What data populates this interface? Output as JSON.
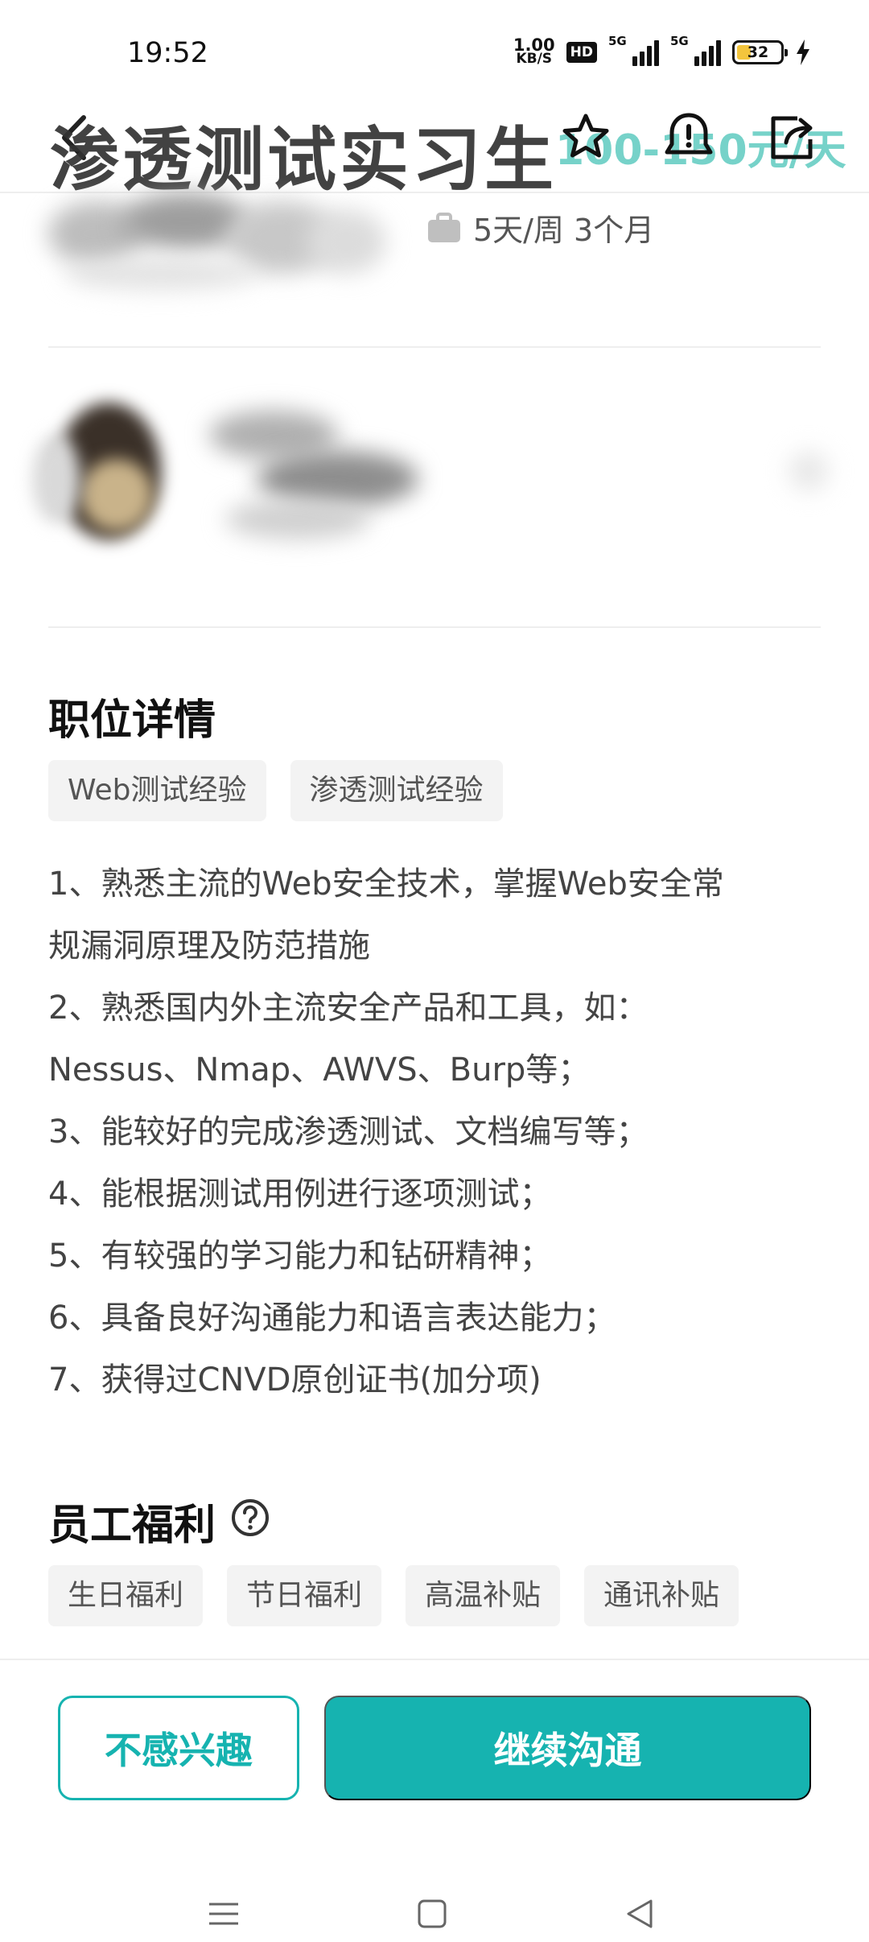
{
  "status_bar": {
    "time": "19:52",
    "net_speed_value": "1.00",
    "net_speed_unit": "KB/S",
    "hd_label": "HD",
    "signal1_label": "5G",
    "signal2_label": "5G",
    "battery_level": "32"
  },
  "header": {
    "title": "渗透测试实习生",
    "salary": "100-150元/天"
  },
  "job_meta": {
    "schedule": "5天/周 3个月"
  },
  "job_details": {
    "title": "职位详情",
    "tags": [
      "Web测试经验",
      "渗透测试经验"
    ],
    "lines": [
      "1、熟悉主流的Web安全技术，掌握Web安全常",
      "规漏洞原理及防范措施",
      "2、熟悉国内外主流安全产品和工具，如：",
      "Nessus、Nmap、AWVS、Burp等；",
      "3、能较好的完成渗透测试、文档编写等；",
      "4、能根据测试用例进行逐项测试；",
      "5、有较强的学习能力和钻研精神；",
      "6、具备良好沟通能力和语言表达能力；",
      "7、获得过CNVD原创证书(加分项)"
    ]
  },
  "benefits": {
    "title": "员工福利",
    "tags": [
      "生日福利",
      "节日福利",
      "高温补贴",
      "通讯补贴"
    ]
  },
  "actions": {
    "not_interested": "不感兴趣",
    "continue_chat": "继续沟通"
  },
  "colors": {
    "accent": "#16b3b0",
    "accent_light": "#76d2c9",
    "tag_bg": "#f3f3f3"
  }
}
